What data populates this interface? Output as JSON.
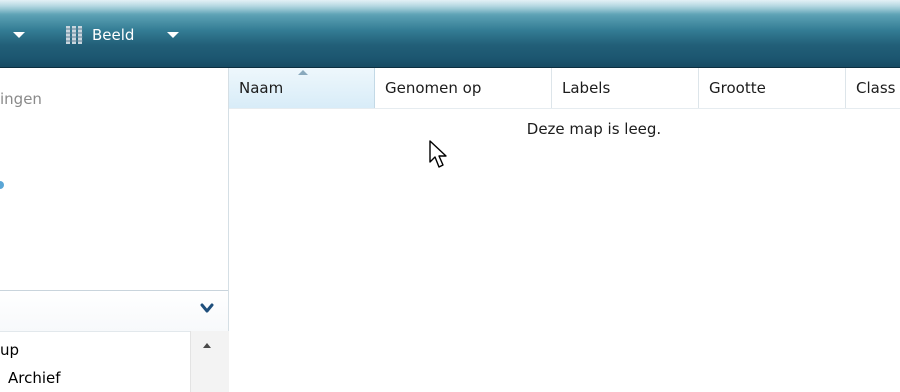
{
  "toolbar": {
    "views_label": "Beeld",
    "accent_colors": [
      "#1c5670",
      "#347d95"
    ]
  },
  "navigation": {
    "favorites_partial_label": "ingen",
    "tree_items": [
      {
        "label": "up"
      },
      {
        "label": "Archief"
      }
    ]
  },
  "list": {
    "columns": [
      "Naam",
      "Genomen op",
      "Labels",
      "Grootte",
      "Class"
    ],
    "sorted_column": "Naam",
    "empty_message": "Deze map is leeg."
  },
  "icons": {
    "toolbar_dropdown": "chevron-down-icon",
    "views": "views-icon",
    "folders_collapse": "chevron-down-icon",
    "scroll_up": "arrow-up-icon",
    "cursor": "mouse-pointer-icon",
    "sort": "sort-ascending-icon"
  }
}
